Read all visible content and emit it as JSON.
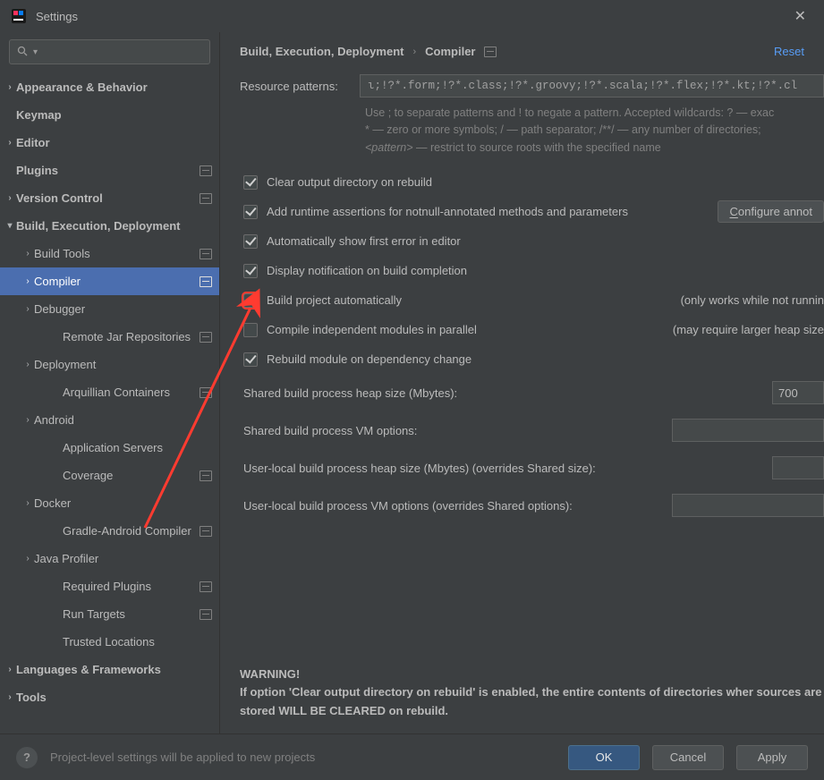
{
  "window": {
    "title": "Settings"
  },
  "breadcrumb": {
    "parent": "Build, Execution, Deployment",
    "current": "Compiler",
    "reset": "Reset"
  },
  "sidebar": {
    "items": [
      {
        "label": "Appearance & Behavior",
        "level": "top",
        "chev": ">",
        "proj": false
      },
      {
        "label": "Keymap",
        "level": "top",
        "chev": "",
        "proj": false
      },
      {
        "label": "Editor",
        "level": "top",
        "chev": ">",
        "proj": false
      },
      {
        "label": "Plugins",
        "level": "top",
        "chev": "",
        "proj": true
      },
      {
        "label": "Version Control",
        "level": "top",
        "chev": ">",
        "proj": true
      },
      {
        "label": "Build, Execution, Deployment",
        "level": "top",
        "chev": "v",
        "proj": false,
        "bold": true
      },
      {
        "label": "Build Tools",
        "level": "sub",
        "chev": ">",
        "proj": true
      },
      {
        "label": "Compiler",
        "level": "sub",
        "chev": ">",
        "proj": true,
        "selected": true
      },
      {
        "label": "Debugger",
        "level": "sub",
        "chev": ">",
        "proj": false
      },
      {
        "label": "Remote Jar Repositories",
        "level": "subsub",
        "chev": "",
        "proj": true
      },
      {
        "label": "Deployment",
        "level": "sub",
        "chev": ">",
        "proj": false
      },
      {
        "label": "Arquillian Containers",
        "level": "subsub",
        "chev": "",
        "proj": true
      },
      {
        "label": "Android",
        "level": "sub",
        "chev": ">",
        "proj": false
      },
      {
        "label": "Application Servers",
        "level": "subsub",
        "chev": "",
        "proj": false
      },
      {
        "label": "Coverage",
        "level": "subsub",
        "chev": "",
        "proj": true
      },
      {
        "label": "Docker",
        "level": "sub",
        "chev": ">",
        "proj": false
      },
      {
        "label": "Gradle-Android Compiler",
        "level": "subsub",
        "chev": "",
        "proj": true
      },
      {
        "label": "Java Profiler",
        "level": "sub",
        "chev": ">",
        "proj": false
      },
      {
        "label": "Required Plugins",
        "level": "subsub",
        "chev": "",
        "proj": true
      },
      {
        "label": "Run Targets",
        "level": "subsub",
        "chev": "",
        "proj": true
      },
      {
        "label": "Trusted Locations",
        "level": "subsub",
        "chev": "",
        "proj": false
      },
      {
        "label": "Languages & Frameworks",
        "level": "top",
        "chev": ">",
        "proj": false
      },
      {
        "label": "Tools",
        "level": "top",
        "chev": ">",
        "proj": false
      }
    ]
  },
  "form": {
    "resource_label": "Resource patterns:",
    "resource_value": "ι;!?*.form;!?*.class;!?*.groovy;!?*.scala;!?*.flex;!?*.kt;!?*.cl",
    "hint1": "Use ; to separate patterns and ! to negate a pattern. Accepted wildcards: ? — exac",
    "hint2": "* — zero or more symbols; / — path separator; /**/ — any number of directories;",
    "hint3_a": "<pattern>",
    "hint3_b": " — restrict to source roots with the specified name",
    "c1": "Clear output directory on rebuild",
    "c2": "Add runtime assertions for notnull-annotated methods and parameters",
    "c2btn_pre": "C",
    "c2btn_rest": "onfigure annot",
    "c3": "Automatically show first error in editor",
    "c4": "Display notification on build completion",
    "c5": "Build project automatically",
    "c5note": "(only works while not runnin",
    "c6": "Compile independent modules in parallel",
    "c6note": "(may require larger heap size",
    "c7": "Rebuild module on dependency change",
    "f1": "Shared build process heap size (Mbytes):",
    "f1v": "700",
    "f2": "Shared build process VM options:",
    "f3": "User-local build process heap size (Mbytes) (overrides Shared size):",
    "f4": "User-local build process VM options (overrides Shared options):",
    "warn_h": "WARNING!",
    "warn_b": "If option 'Clear output directory on rebuild' is enabled, the entire contents of directories wher sources are stored WILL BE CLEARED on rebuild."
  },
  "footer": {
    "note": "Project-level settings will be applied to new projects",
    "ok": "OK",
    "cancel": "Cancel",
    "apply": "Apply"
  }
}
